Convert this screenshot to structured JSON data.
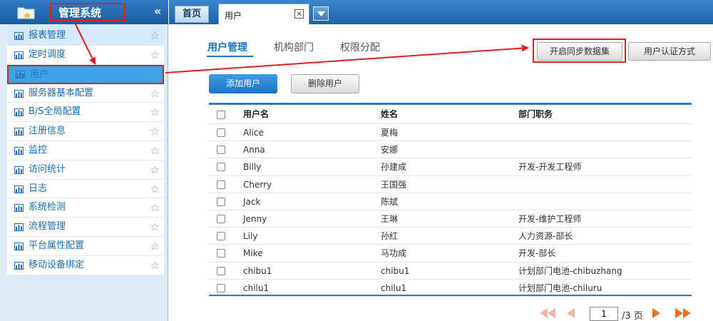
{
  "sidebar": {
    "title": "管理系统",
    "collapse_label": "«",
    "items": [
      {
        "label": "报表管理"
      },
      {
        "label": "定时调度"
      },
      {
        "label": "用户"
      },
      {
        "label": "服务器基本配置"
      },
      {
        "label": "B/S全局配置"
      },
      {
        "label": "注册信息"
      },
      {
        "label": "监控"
      },
      {
        "label": "访问统计"
      },
      {
        "label": "日志"
      },
      {
        "label": "系统检测"
      },
      {
        "label": "流程管理"
      },
      {
        "label": "平台属性配置"
      },
      {
        "label": "移动设备绑定"
      }
    ],
    "star_glyph": "☆"
  },
  "tabs": {
    "home": "首页",
    "user": "用户",
    "close_glyph": "×"
  },
  "subtabs": [
    "用户管理",
    "机构部门",
    "权限分配"
  ],
  "toolbar": {
    "sync": "开启同步数据集",
    "auth": "用户认证方式",
    "add": "添加用户",
    "delete": "删除用户"
  },
  "table": {
    "headers": [
      "用户名",
      "姓名",
      "部门职务"
    ],
    "rows": [
      [
        "Alice",
        "夏梅",
        ""
      ],
      [
        "Anna",
        "安娜",
        ""
      ],
      [
        "Billy",
        "孙建成",
        "开发-开发工程师"
      ],
      [
        "Cherry",
        "王国强",
        ""
      ],
      [
        "Jack",
        "陈斌",
        ""
      ],
      [
        "Jenny",
        "王琳",
        "开发-维护工程师"
      ],
      [
        "Lily",
        "孙红",
        "人力资源-部长"
      ],
      [
        "Mike",
        "马功成",
        "开发-部长"
      ],
      [
        "chibu1",
        "chibu1",
        "计划部门电池-chibuzhang"
      ],
      [
        "chilu1",
        "chilu1",
        "计划部门电池-chiluru"
      ]
    ]
  },
  "pager": {
    "current": "1",
    "total": "/3 页"
  },
  "colors": {
    "accent": "#1a75c9",
    "header_blue": "#1d62a6",
    "annotation_red": "#e02020",
    "selected_item": "#39a5e8"
  }
}
